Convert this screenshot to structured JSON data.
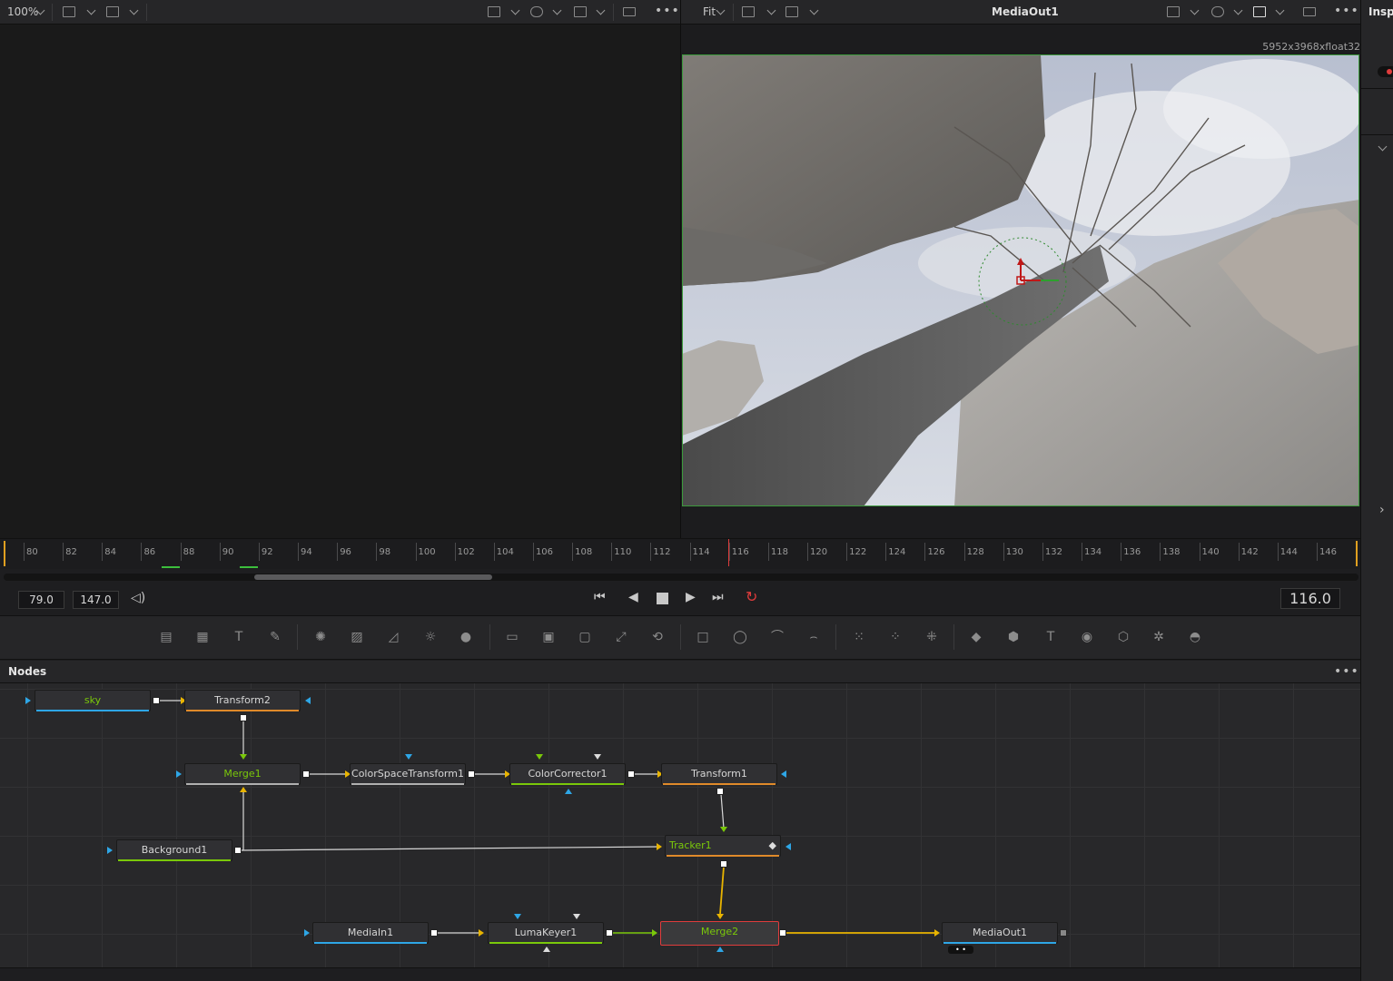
{
  "left_viewer": {
    "zoom": "100%"
  },
  "right_viewer": {
    "zoom": "Fit",
    "title": "MediaOut1",
    "resolution": "5952x3968xfloat32",
    "inspector_label": "Inspe"
  },
  "timeline": {
    "ticks": [
      "80",
      "82",
      "84",
      "86",
      "88",
      "90",
      "92",
      "94",
      "96",
      "98",
      "100",
      "102",
      "104",
      "106",
      "108",
      "110",
      "112",
      "114",
      "116",
      "118",
      "120",
      "122",
      "124",
      "126",
      "128",
      "130",
      "132",
      "134",
      "136",
      "138",
      "140",
      "142",
      "144",
      "146"
    ]
  },
  "transport": {
    "start": "79.0",
    "end": "147.0",
    "current_frame": "116.0"
  },
  "nodes_panel": {
    "title": "Nodes",
    "menu": "•••"
  },
  "nodes": {
    "sky": "sky",
    "transform2": "Transform2",
    "merge1": "Merge1",
    "colorspace": "ColorSpaceTransform1",
    "colorcorrector": "ColorCorrector1",
    "transform1": "Transform1",
    "background1": "Background1",
    "tracker1": "Tracker1",
    "mediain1": "MediaIn1",
    "lumakeyer1": "LumaKeyer1",
    "merge2": "Merge2",
    "mediaout1": "MediaOut1"
  },
  "toolbar_icons": [
    "gradient-icon",
    "fastnoise-icon",
    "text-icon",
    "paint-icon",
    "particle-icon",
    "grid-icon",
    "curve-icon",
    "brightness-icon",
    "drop-icon",
    "loader-icon",
    "merge-icon",
    "mask-icon",
    "resize-icon",
    "transform-icon",
    "rectangle-icon",
    "ellipse-icon",
    "polygon-icon",
    "bspline-icon",
    "particles-emitter-icon",
    "particles-render-icon",
    "particles-bounds-icon",
    "shape3d-icon",
    "merge3d-icon",
    "text3d-icon",
    "camera3d-icon",
    "render3d-icon",
    "light3d-icon",
    "image-plane-icon"
  ],
  "colors": {
    "accent_orange": "#e08a2a",
    "link_yellow": "#e8b400",
    "link_green": "#7ac80a",
    "selected_red": "#e03c3c",
    "port_blue": "#2ea6e6"
  }
}
